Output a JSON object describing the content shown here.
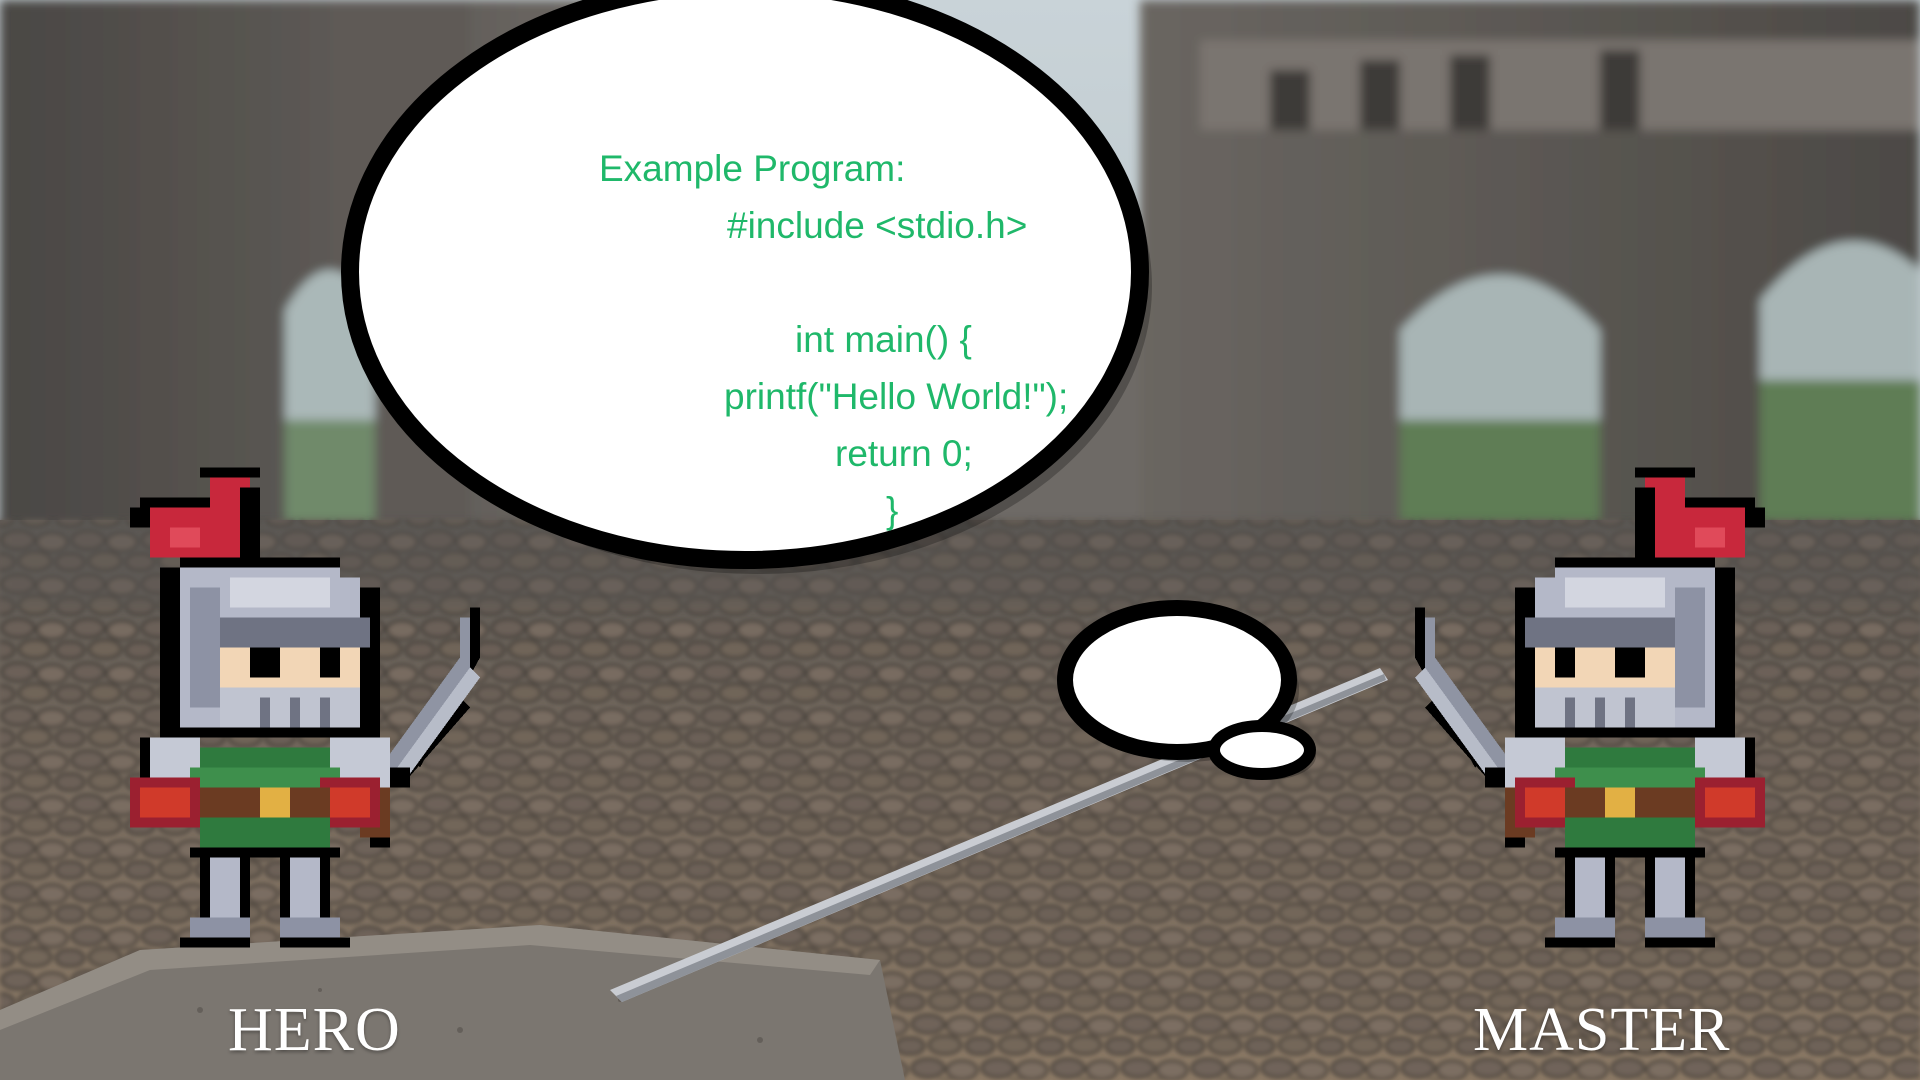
{
  "scene": {
    "background": "castle-courtyard-with-cobblestones",
    "colors": {
      "code_text": "#1fb86a",
      "label_text": "#ffffff",
      "bubble_fill": "#ffffff",
      "bubble_outline": "#000000",
      "plume": "#c8283c",
      "armor": "#b4b8c8",
      "tunic": "#2f7a3e"
    }
  },
  "speech_bubble": {
    "heading": "Example Program:",
    "lines": [
      "#include <stdio.h>",
      "int main() {",
      "printf(\"Hello World!\");",
      "return 0;",
      "}"
    ]
  },
  "characters": [
    {
      "label": "HERO",
      "sprite": "knight-with-sword"
    },
    {
      "label": "MASTER",
      "sprite": "knight-with-sword"
    }
  ]
}
